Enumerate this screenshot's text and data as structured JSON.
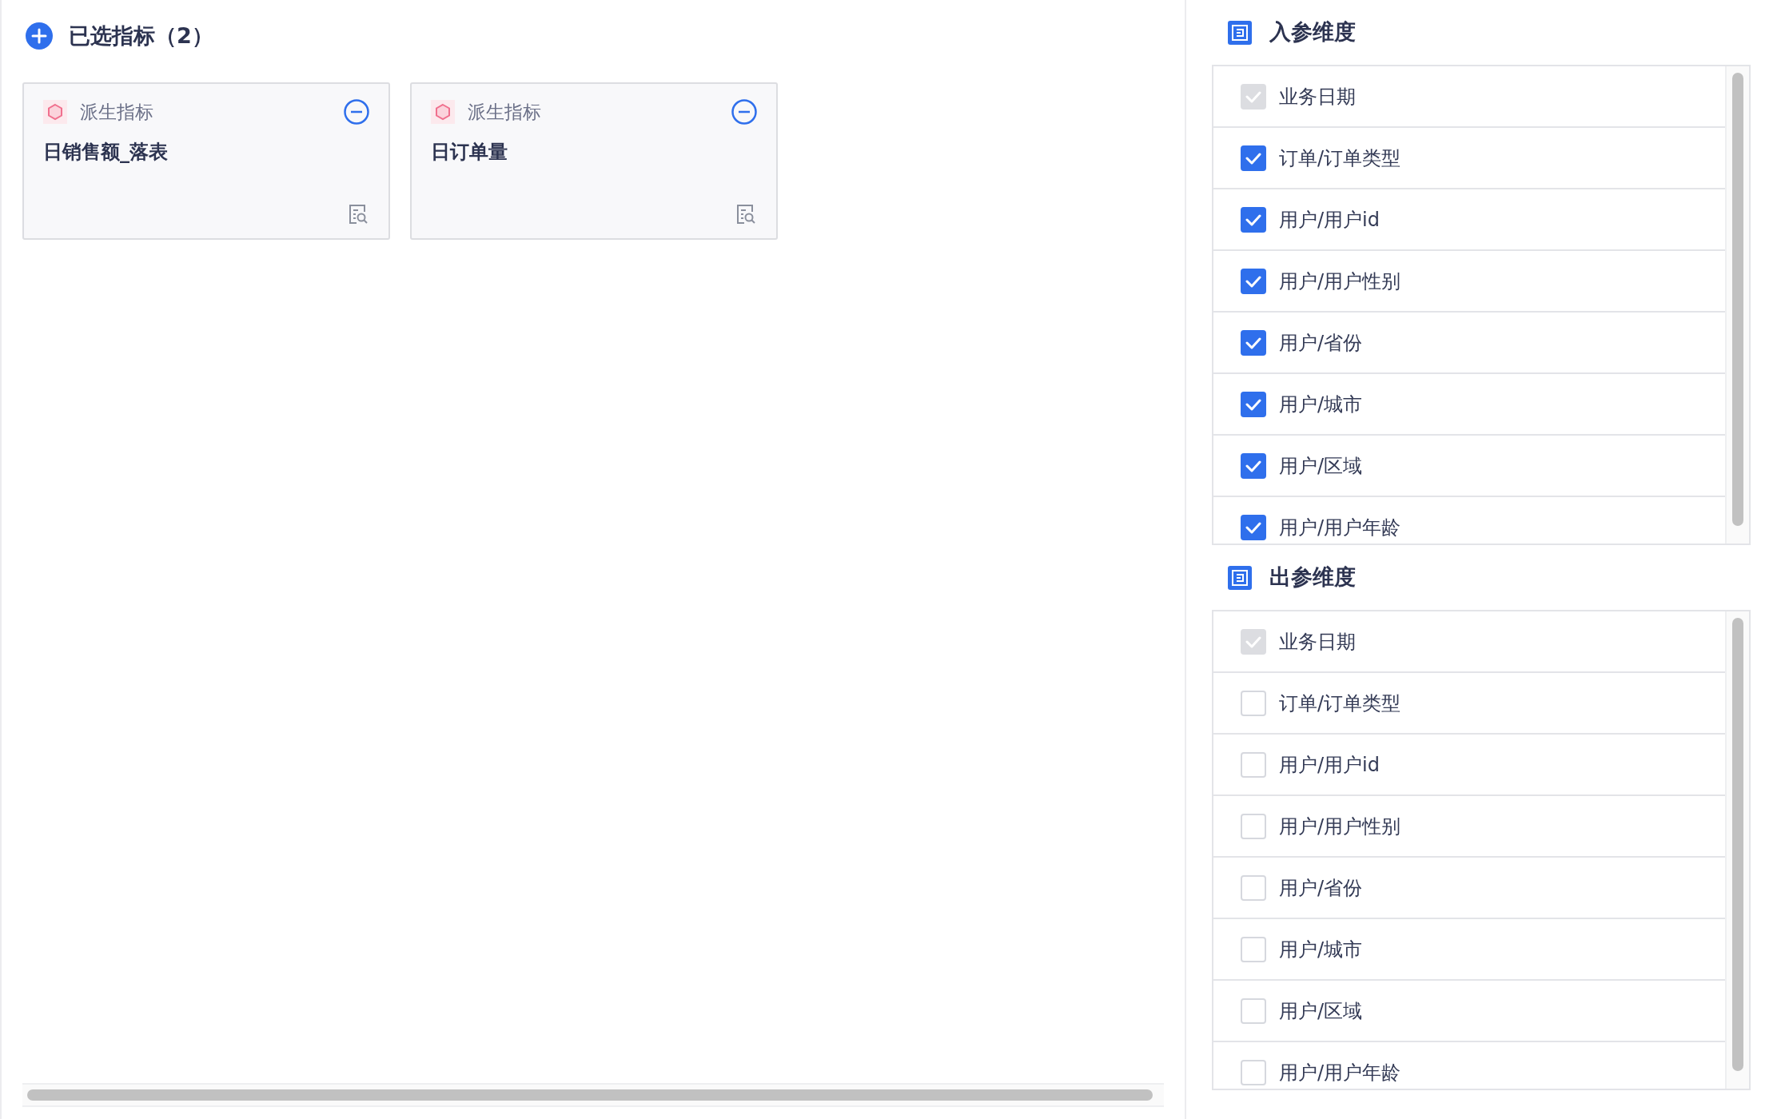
{
  "selected_metrics": {
    "title": "已选指标（2）",
    "cards": [
      {
        "type": "派生指标",
        "name": "日销售额_落表"
      },
      {
        "type": "派生指标",
        "name": "日订单量"
      }
    ]
  },
  "input_dimensions": {
    "title": "入参维度",
    "items": [
      {
        "label": "业务日期",
        "checked": true,
        "disabled": true
      },
      {
        "label": "订单/订单类型",
        "checked": true,
        "disabled": false
      },
      {
        "label": "用户/用户id",
        "checked": true,
        "disabled": false
      },
      {
        "label": "用户/用户性别",
        "checked": true,
        "disabled": false
      },
      {
        "label": "用户/省份",
        "checked": true,
        "disabled": false
      },
      {
        "label": "用户/城市",
        "checked": true,
        "disabled": false
      },
      {
        "label": "用户/区域",
        "checked": true,
        "disabled": false
      },
      {
        "label": "用户/用户年龄",
        "checked": true,
        "disabled": false
      }
    ]
  },
  "output_dimensions": {
    "title": "出参维度",
    "items": [
      {
        "label": "业务日期",
        "checked": true,
        "disabled": true
      },
      {
        "label": "订单/订单类型",
        "checked": false,
        "disabled": false
      },
      {
        "label": "用户/用户id",
        "checked": false,
        "disabled": false
      },
      {
        "label": "用户/用户性别",
        "checked": false,
        "disabled": false
      },
      {
        "label": "用户/省份",
        "checked": false,
        "disabled": false
      },
      {
        "label": "用户/城市",
        "checked": false,
        "disabled": false
      },
      {
        "label": "用户/区域",
        "checked": false,
        "disabled": false
      },
      {
        "label": "用户/用户年龄",
        "checked": false,
        "disabled": false
      }
    ]
  }
}
